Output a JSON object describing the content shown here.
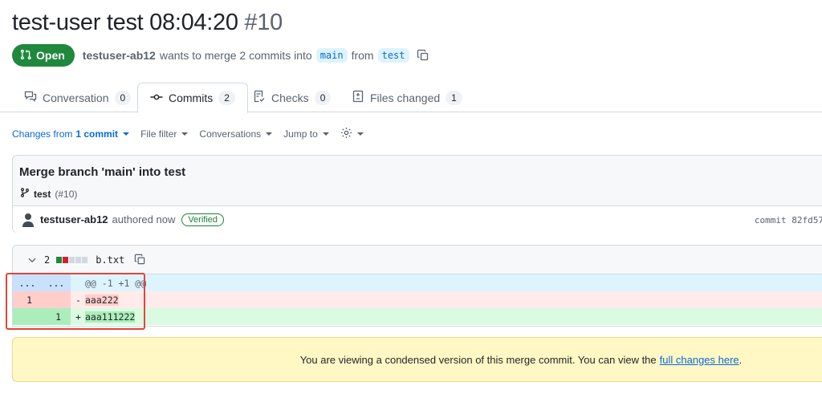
{
  "pr": {
    "title": "test-user test 08:04:20",
    "number": "#10",
    "state": "Open",
    "author": "testuser-ab12",
    "merge_text": "wants to merge 2 commits into",
    "base_branch": "main",
    "from_text": "from",
    "head_branch": "test"
  },
  "tabs": [
    {
      "label": "Conversation",
      "count": "0",
      "icon": "comment-discussion-icon"
    },
    {
      "label": "Commits",
      "count": "2",
      "icon": "git-commit-icon"
    },
    {
      "label": "Checks",
      "count": "0",
      "icon": "checklist-icon"
    },
    {
      "label": "Files changed",
      "count": "1",
      "icon": "file-diff-icon"
    }
  ],
  "toolbar": {
    "changes_prefix": "Changes from",
    "changes_count": "1 commit",
    "file_filter": "File filter",
    "conversations": "Conversations",
    "jump_to": "Jump to",
    "settings_icon": "gear-icon"
  },
  "commit": {
    "title": "Merge branch 'main' into test",
    "branch": "test",
    "pr_ref": "(#10)",
    "author": "testuser-ab12",
    "authored": "authored now",
    "verified": "Verified",
    "sha_label": "commit 82fd57"
  },
  "file": {
    "changes": "2",
    "name": "b.txt",
    "diffstat": [
      "add",
      "del",
      "neutral",
      "neutral",
      "neutral"
    ],
    "hunk": {
      "old": "...",
      "new": "...",
      "header": "@@ -1 +1 @@"
    },
    "lines": [
      {
        "type": "del",
        "old": "1",
        "new": "",
        "sign": "-",
        "text": "aaa222"
      },
      {
        "type": "add",
        "old": "",
        "new": "1",
        "sign": "+",
        "text": "aaa111222"
      }
    ]
  },
  "notice": {
    "text": "You are viewing a condensed version of this merge commit. You can view the",
    "link": "full changes here",
    "end": "."
  },
  "colors": {
    "open_green": "#1f883d",
    "link_blue": "#0969da",
    "annotation_red": "#e5443a"
  }
}
